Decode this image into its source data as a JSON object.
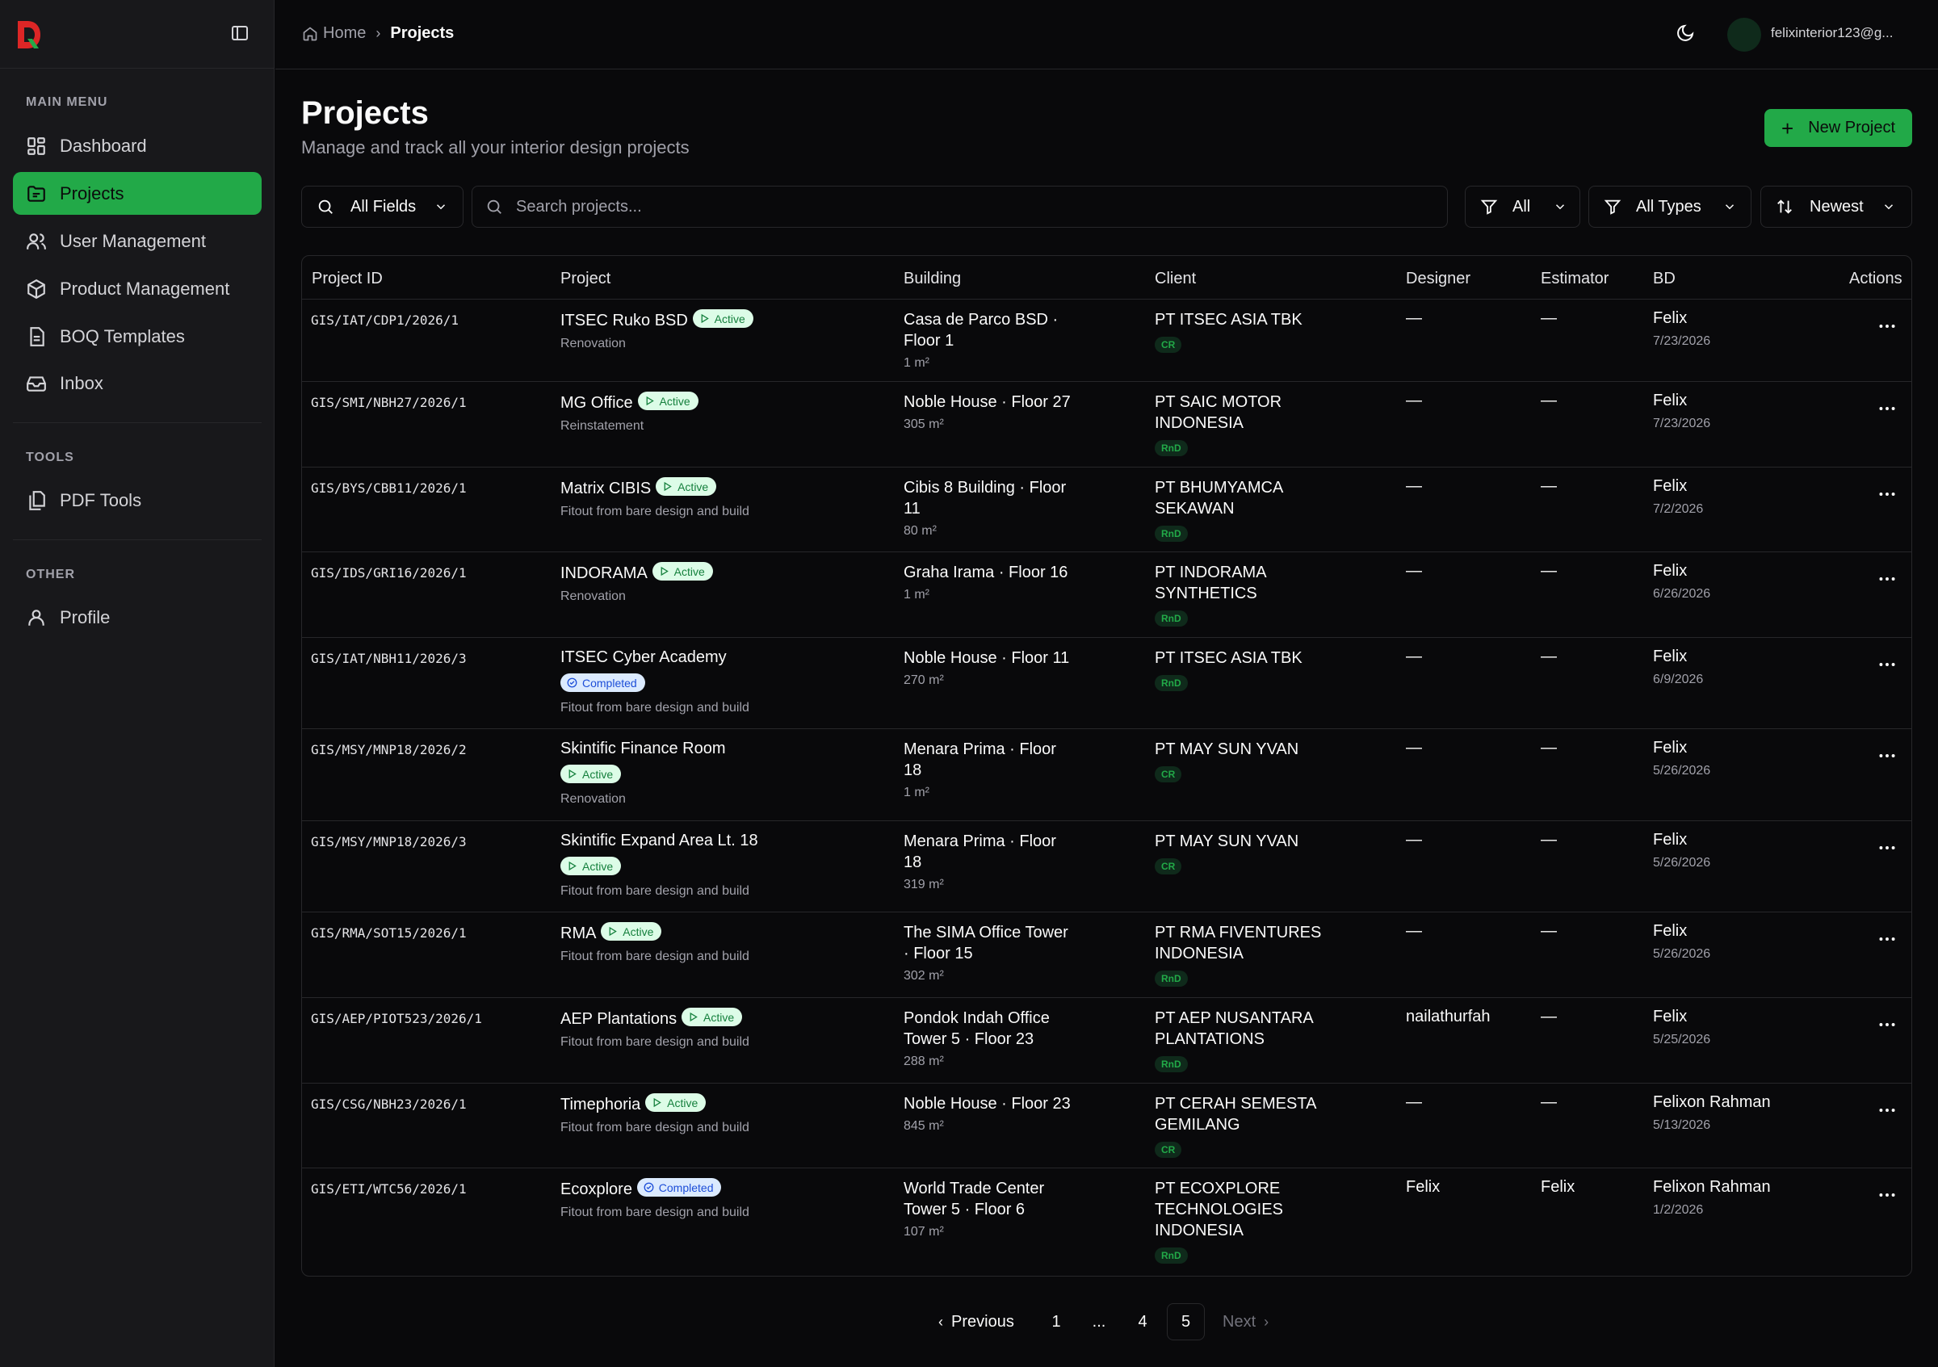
{
  "app": {
    "user_email": "felixinterior123@g..."
  },
  "sidebar": {
    "main_menu_label": "MAIN MENU",
    "tools_label": "TOOLS",
    "other_label": "OTHER",
    "items": [
      {
        "label": "Dashboard",
        "icon": "dashboard-icon"
      },
      {
        "label": "Projects",
        "icon": "folder-icon",
        "active": true
      },
      {
        "label": "User Management",
        "icon": "users-icon"
      },
      {
        "label": "Product Management",
        "icon": "package-icon"
      },
      {
        "label": "BOQ Templates",
        "icon": "document-icon"
      },
      {
        "label": "Inbox",
        "icon": "inbox-icon"
      }
    ],
    "tools": [
      {
        "label": "PDF Tools",
        "icon": "files-icon"
      }
    ],
    "other": [
      {
        "label": "Profile",
        "icon": "user-icon"
      }
    ]
  },
  "breadcrumb": {
    "home": "Home",
    "current": "Projects"
  },
  "page": {
    "title": "Projects",
    "subtitle": "Manage and track all your interior design projects",
    "new_button": "New Project"
  },
  "filters": {
    "field_select": "All Fields",
    "search_placeholder": "Search projects...",
    "status_filter": "All",
    "type_filter": "All Types",
    "sort": "Newest"
  },
  "table": {
    "headers": [
      "Project ID",
      "Project",
      "Building",
      "Client",
      "Designer",
      "Estimator",
      "BD",
      "Actions"
    ],
    "rows": [
      {
        "id": "GIS/IAT/CDP1/2026/1",
        "name": "ITSEC Ruko BSD",
        "status": "Active",
        "type": "Renovation",
        "building": "Casa de Parco BSD · Floor 1",
        "area": "1 m²",
        "client": "PT ITSEC ASIA TBK",
        "tag": "CR",
        "designer": "—",
        "estimator": "—",
        "bd": "Felix",
        "date": "7/23/2026"
      },
      {
        "id": "GIS/SMI/NBH27/2026/1",
        "name": "MG Office",
        "status": "Active",
        "type": "Reinstatement",
        "building": "Noble House · Floor 27",
        "area": "305 m²",
        "client": "PT SAIC MOTOR INDONESIA",
        "tag": "RnD",
        "designer": "—",
        "estimator": "—",
        "bd": "Felix",
        "date": "7/23/2026"
      },
      {
        "id": "GIS/BYS/CBB11/2026/1",
        "name": "Matrix CIBIS",
        "status": "Active",
        "type": "Fitout from bare design and build",
        "building": "Cibis 8 Building · Floor 11",
        "area": "80 m²",
        "client": "PT BHUMYAMCA SEKAWAN",
        "tag": "RnD",
        "designer": "—",
        "estimator": "—",
        "bd": "Felix",
        "date": "7/2/2026"
      },
      {
        "id": "GIS/IDS/GRI16/2026/1",
        "name": "INDORAMA",
        "status": "Active",
        "type": "Renovation",
        "building": "Graha Irama · Floor 16",
        "area": "1 m²",
        "client": "PT INDORAMA SYNTHETICS",
        "tag": "RnD",
        "designer": "—",
        "estimator": "—",
        "bd": "Felix",
        "date": "6/26/2026"
      },
      {
        "id": "GIS/IAT/NBH11/2026/3",
        "name": "ITSEC Cyber Academy",
        "status": "Completed",
        "type": "Fitout from bare design and build",
        "building": "Noble House · Floor 11",
        "area": "270 m²",
        "client": "PT ITSEC ASIA TBK",
        "tag": "RnD",
        "designer": "—",
        "estimator": "—",
        "bd": "Felix",
        "date": "6/9/2026"
      },
      {
        "id": "GIS/MSY/MNP18/2026/2",
        "name": "Skintific Finance Room",
        "status": "Active",
        "type": "Renovation",
        "building": "Menara Prima · Floor 18",
        "area": "1 m²",
        "client": "PT MAY SUN YVAN",
        "tag": "CR",
        "designer": "—",
        "estimator": "—",
        "bd": "Felix",
        "date": "5/26/2026"
      },
      {
        "id": "GIS/MSY/MNP18/2026/3",
        "name": "Skintific Expand Area Lt. 18",
        "status": "Active",
        "type": "Fitout from bare design and build",
        "building": "Menara Prima · Floor 18",
        "area": "319 m²",
        "client": "PT MAY SUN YVAN",
        "tag": "CR",
        "designer": "—",
        "estimator": "—",
        "bd": "Felix",
        "date": "5/26/2026"
      },
      {
        "id": "GIS/RMA/SOT15/2026/1",
        "name": "RMA",
        "status": "Active",
        "type": "Fitout from bare design and build",
        "building": "The SIMA Office Tower · Floor 15",
        "area": "302 m²",
        "client": "PT RMA FIVENTURES INDONESIA",
        "tag": "RnD",
        "designer": "—",
        "estimator": "—",
        "bd": "Felix",
        "date": "5/26/2026"
      },
      {
        "id": "GIS/AEP/PIOT523/2026/1",
        "name": "AEP Plantations",
        "status": "Active",
        "type": "Fitout from bare design and build",
        "building": "Pondok Indah Office Tower 5 · Floor 23",
        "area": "288 m²",
        "client": "PT AEP NUSANTARA PLANTATIONS",
        "tag": "RnD",
        "designer": "nailathurfah",
        "estimator": "—",
        "bd": "Felix",
        "date": "5/25/2026"
      },
      {
        "id": "GIS/CSG/NBH23/2026/1",
        "name": "Timephoria",
        "status": "Active",
        "type": "Fitout from bare design and build",
        "building": "Noble House · Floor 23",
        "area": "845 m²",
        "client": "PT CERAH SEMESTA GEMILANG",
        "tag": "CR",
        "designer": "—",
        "estimator": "—",
        "bd": "Felixon Rahman",
        "date": "5/13/2026"
      },
      {
        "id": "GIS/ETI/WTC56/2026/1",
        "name": "Ecoxplore",
        "status": "Completed",
        "type": "Fitout from bare design and build",
        "building": "World Trade Center Tower 5 · Floor 6",
        "area": "107 m²",
        "client": "PT ECOXPLORE TECHNOLOGIES INDONESIA",
        "tag": "RnD",
        "designer": "Felix",
        "estimator": "Felix",
        "bd": "Felixon Rahman",
        "date": "1/2/2026"
      }
    ]
  },
  "pagination": {
    "previous": "Previous",
    "next": "Next",
    "pages": [
      "1",
      "...",
      "4",
      "5"
    ],
    "current": "5"
  },
  "colors": {
    "accent": "#22a948",
    "background": "#09090b",
    "sidebar": "#18181b",
    "border": "#27272a"
  }
}
